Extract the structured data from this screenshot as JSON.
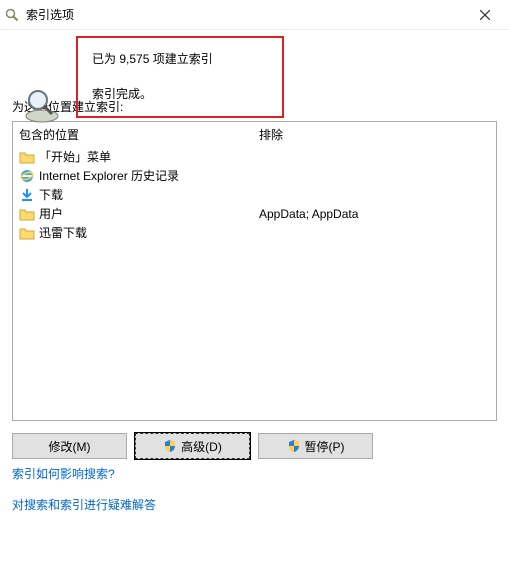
{
  "window": {
    "title": "索引选项"
  },
  "status": {
    "line1": "已为 9,575 项建立索引",
    "line2": "索引完成。"
  },
  "section_label": "为这些位置建立索引:",
  "columns": {
    "include": "包含的位置",
    "exclude": "排除"
  },
  "rows": [
    {
      "icon": "folder",
      "label": "「开始」菜单",
      "exclude": ""
    },
    {
      "icon": "ie",
      "label": "Internet Explorer 历史记录",
      "exclude": ""
    },
    {
      "icon": "dl",
      "label": "下载",
      "exclude": ""
    },
    {
      "icon": "folder",
      "label": "用户",
      "exclude": "AppData; AppData"
    },
    {
      "icon": "folder",
      "label": "迅雷下载",
      "exclude": ""
    }
  ],
  "buttons": {
    "modify": "修改(M)",
    "advanced": "高级(D)",
    "pause": "暂停(P)"
  },
  "links": {
    "link1": "索引如何影响搜索?",
    "link2": "对搜索和索引进行疑难解答"
  }
}
